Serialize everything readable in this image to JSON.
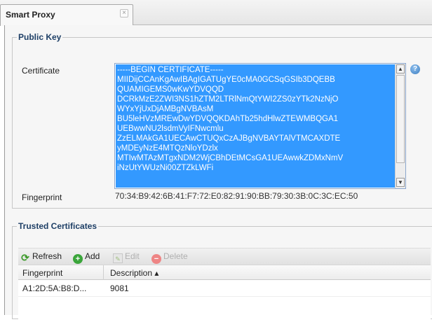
{
  "tab": {
    "title": "Smart Proxy",
    "close_glyph": "×"
  },
  "public_key": {
    "legend": "Public Key",
    "certificate_label": "Certificate",
    "certificate_lines": [
      "-----BEGIN CERTIFICATE-----",
      "MIIDijCCAnKgAwIBAgIGATUgYE0cMA0GCSqGSIb3DQEBB",
      "QUAMIGEMS0wKwYDVQQD",
      "DCRkMzE2ZWI3NS1hZTM2LTRlNmQtYWI2ZS0zYTk2NzNjO",
      "WYxYjUxDjAMBgNVBAsM",
      "BU5leHVzMREwDwYDVQQKDAhTb25hdHlwZTEWMBQGA1",
      "UEBwwNU2lsdmVyIFNwcmlu",
      "ZzELMAkGA1UECAwCTUQxCzAJBgNVBAYTAlVTMCAXDTE",
      "yMDEyNzE4MTQzNloYDzlx",
      "MTIwMTAzMTgxNDM2WjCBhDEtMCsGA1UEAwwkZDMxNmV",
      "iNzUtYWUzNi00ZTZkLWFi"
    ],
    "fingerprint_label": "Fingerprint",
    "fingerprint_value": "70:34:B9:42:6B:41:F7:72:E0:82:91:90:BB:79:30:3B:0C:3C:EC:50",
    "help_glyph": "?"
  },
  "trusted_certificates": {
    "legend": "Trusted Certificates",
    "toolbar": {
      "refresh_label": "Refresh",
      "add_label": "Add",
      "edit_label": "Edit",
      "delete_label": "Delete"
    },
    "columns": {
      "fingerprint": "Fingerprint",
      "description": "Description ▴"
    },
    "rows": [
      {
        "fingerprint": "A1:2D:5A:B8:D...",
        "description": "9081"
      }
    ]
  },
  "icons": {
    "refresh": "refresh-icon",
    "add": "add-icon",
    "edit": "edit-icon",
    "delete": "delete-icon",
    "help": "help-icon",
    "close": "close-icon"
  },
  "colors": {
    "selection": "#3399ff",
    "legend": "#1e3f66"
  }
}
